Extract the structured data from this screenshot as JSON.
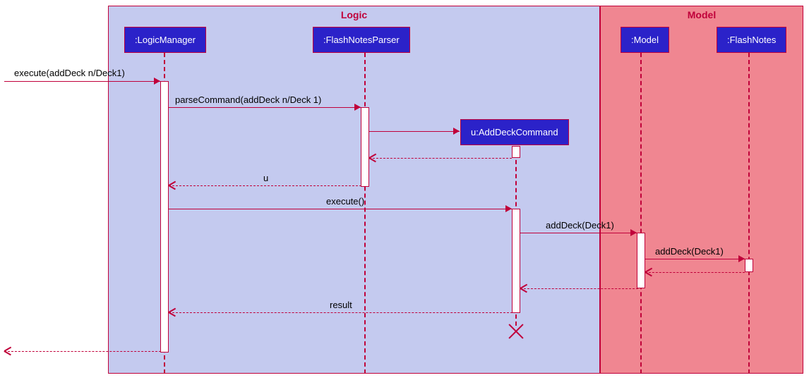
{
  "frames": {
    "logic": "Logic",
    "model": "Model"
  },
  "participants": {
    "logicManager": ":LogicManager",
    "flashNotesParser": ":FlashNotesParser",
    "addDeckCommand": "u:AddDeckCommand",
    "model": ":Model",
    "flashNotes": ":FlashNotes"
  },
  "messages": {
    "execute1": "execute(addDeck n/Deck1)",
    "parseCommand": "parseCommand(addDeck n/Deck 1)",
    "returnU": "u",
    "execute2": "execute()",
    "addDeck1": "addDeck(Deck1)",
    "addDeck2": "addDeck(Deck1)",
    "result": "result"
  },
  "chart_data": {
    "type": "sequence-diagram",
    "frames": [
      {
        "name": "Logic",
        "participants": [
          ":LogicManager",
          ":FlashNotesParser",
          "u:AddDeckCommand"
        ]
      },
      {
        "name": "Model",
        "participants": [
          ":Model",
          ":FlashNotes"
        ]
      }
    ],
    "participants": [
      ":LogicManager",
      ":FlashNotesParser",
      "u:AddDeckCommand",
      ":Model",
      ":FlashNotes"
    ],
    "messages": [
      {
        "from": "external",
        "to": ":LogicManager",
        "label": "execute(addDeck n/Deck1)",
        "type": "sync"
      },
      {
        "from": ":LogicManager",
        "to": ":FlashNotesParser",
        "label": "parseCommand(addDeck n/Deck 1)",
        "type": "sync"
      },
      {
        "from": ":FlashNotesParser",
        "to": "u:AddDeckCommand",
        "label": "",
        "type": "create"
      },
      {
        "from": "u:AddDeckCommand",
        "to": ":FlashNotesParser",
        "label": "",
        "type": "return"
      },
      {
        "from": ":FlashNotesParser",
        "to": ":LogicManager",
        "label": "u",
        "type": "return"
      },
      {
        "from": ":LogicManager",
        "to": "u:AddDeckCommand",
        "label": "execute()",
        "type": "sync"
      },
      {
        "from": "u:AddDeckCommand",
        "to": ":Model",
        "label": "addDeck(Deck1)",
        "type": "sync"
      },
      {
        "from": ":Model",
        "to": ":FlashNotes",
        "label": "addDeck(Deck1)",
        "type": "sync"
      },
      {
        "from": ":FlashNotes",
        "to": ":Model",
        "label": "",
        "type": "return"
      },
      {
        "from": ":Model",
        "to": "u:AddDeckCommand",
        "label": "",
        "type": "return"
      },
      {
        "from": "u:AddDeckCommand",
        "to": ":LogicManager",
        "label": "result",
        "type": "return"
      },
      {
        "from": "u:AddDeckCommand",
        "to": "u:AddDeckCommand",
        "label": "",
        "type": "destroy"
      },
      {
        "from": ":LogicManager",
        "to": "external",
        "label": "",
        "type": "return"
      }
    ]
  }
}
